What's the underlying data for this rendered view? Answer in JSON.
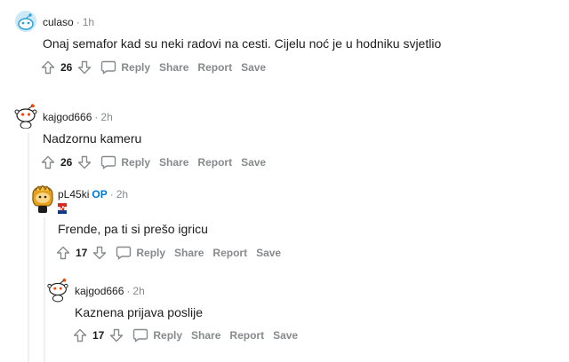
{
  "comments": [
    {
      "author": "culaso",
      "op": "",
      "time": "1h",
      "text": "Onaj semafor kad su neki radovi na cesti. Cijelu noć je u hodniku svjetlio",
      "score": "26",
      "reply": "Reply",
      "share": "Share",
      "report": "Report",
      "save": "Save"
    },
    {
      "author": "kajgod666",
      "op": "",
      "time": "2h",
      "text": "Nadzornu kameru",
      "score": "26",
      "reply": "Reply",
      "share": "Share",
      "report": "Report",
      "save": "Save"
    },
    {
      "author": "pL45ki",
      "op": "OP",
      "time": "2h",
      "text": "Frende, pa ti si prešo igricu",
      "score": "17",
      "reply": "Reply",
      "share": "Share",
      "report": "Report",
      "save": "Save"
    },
    {
      "author": "kajgod666",
      "op": "",
      "time": "2h",
      "text": "Kaznena prijava poslije",
      "score": "17",
      "reply": "Reply",
      "share": "Share",
      "report": "Report",
      "save": "Save"
    }
  ],
  "icons": {
    "upvote": "upvote-arrow-icon",
    "downvote": "downvote-arrow-icon",
    "reply": "speech-bubble-icon",
    "avatar_default": "snoo-avatar-icon",
    "avatar_op": "custom-avatar-icon",
    "flair": "croatia-flag-icon"
  },
  "colors": {
    "op_accent": "#0079d3",
    "meta_grey": "#878a8c",
    "text": "#1c1c1c"
  }
}
